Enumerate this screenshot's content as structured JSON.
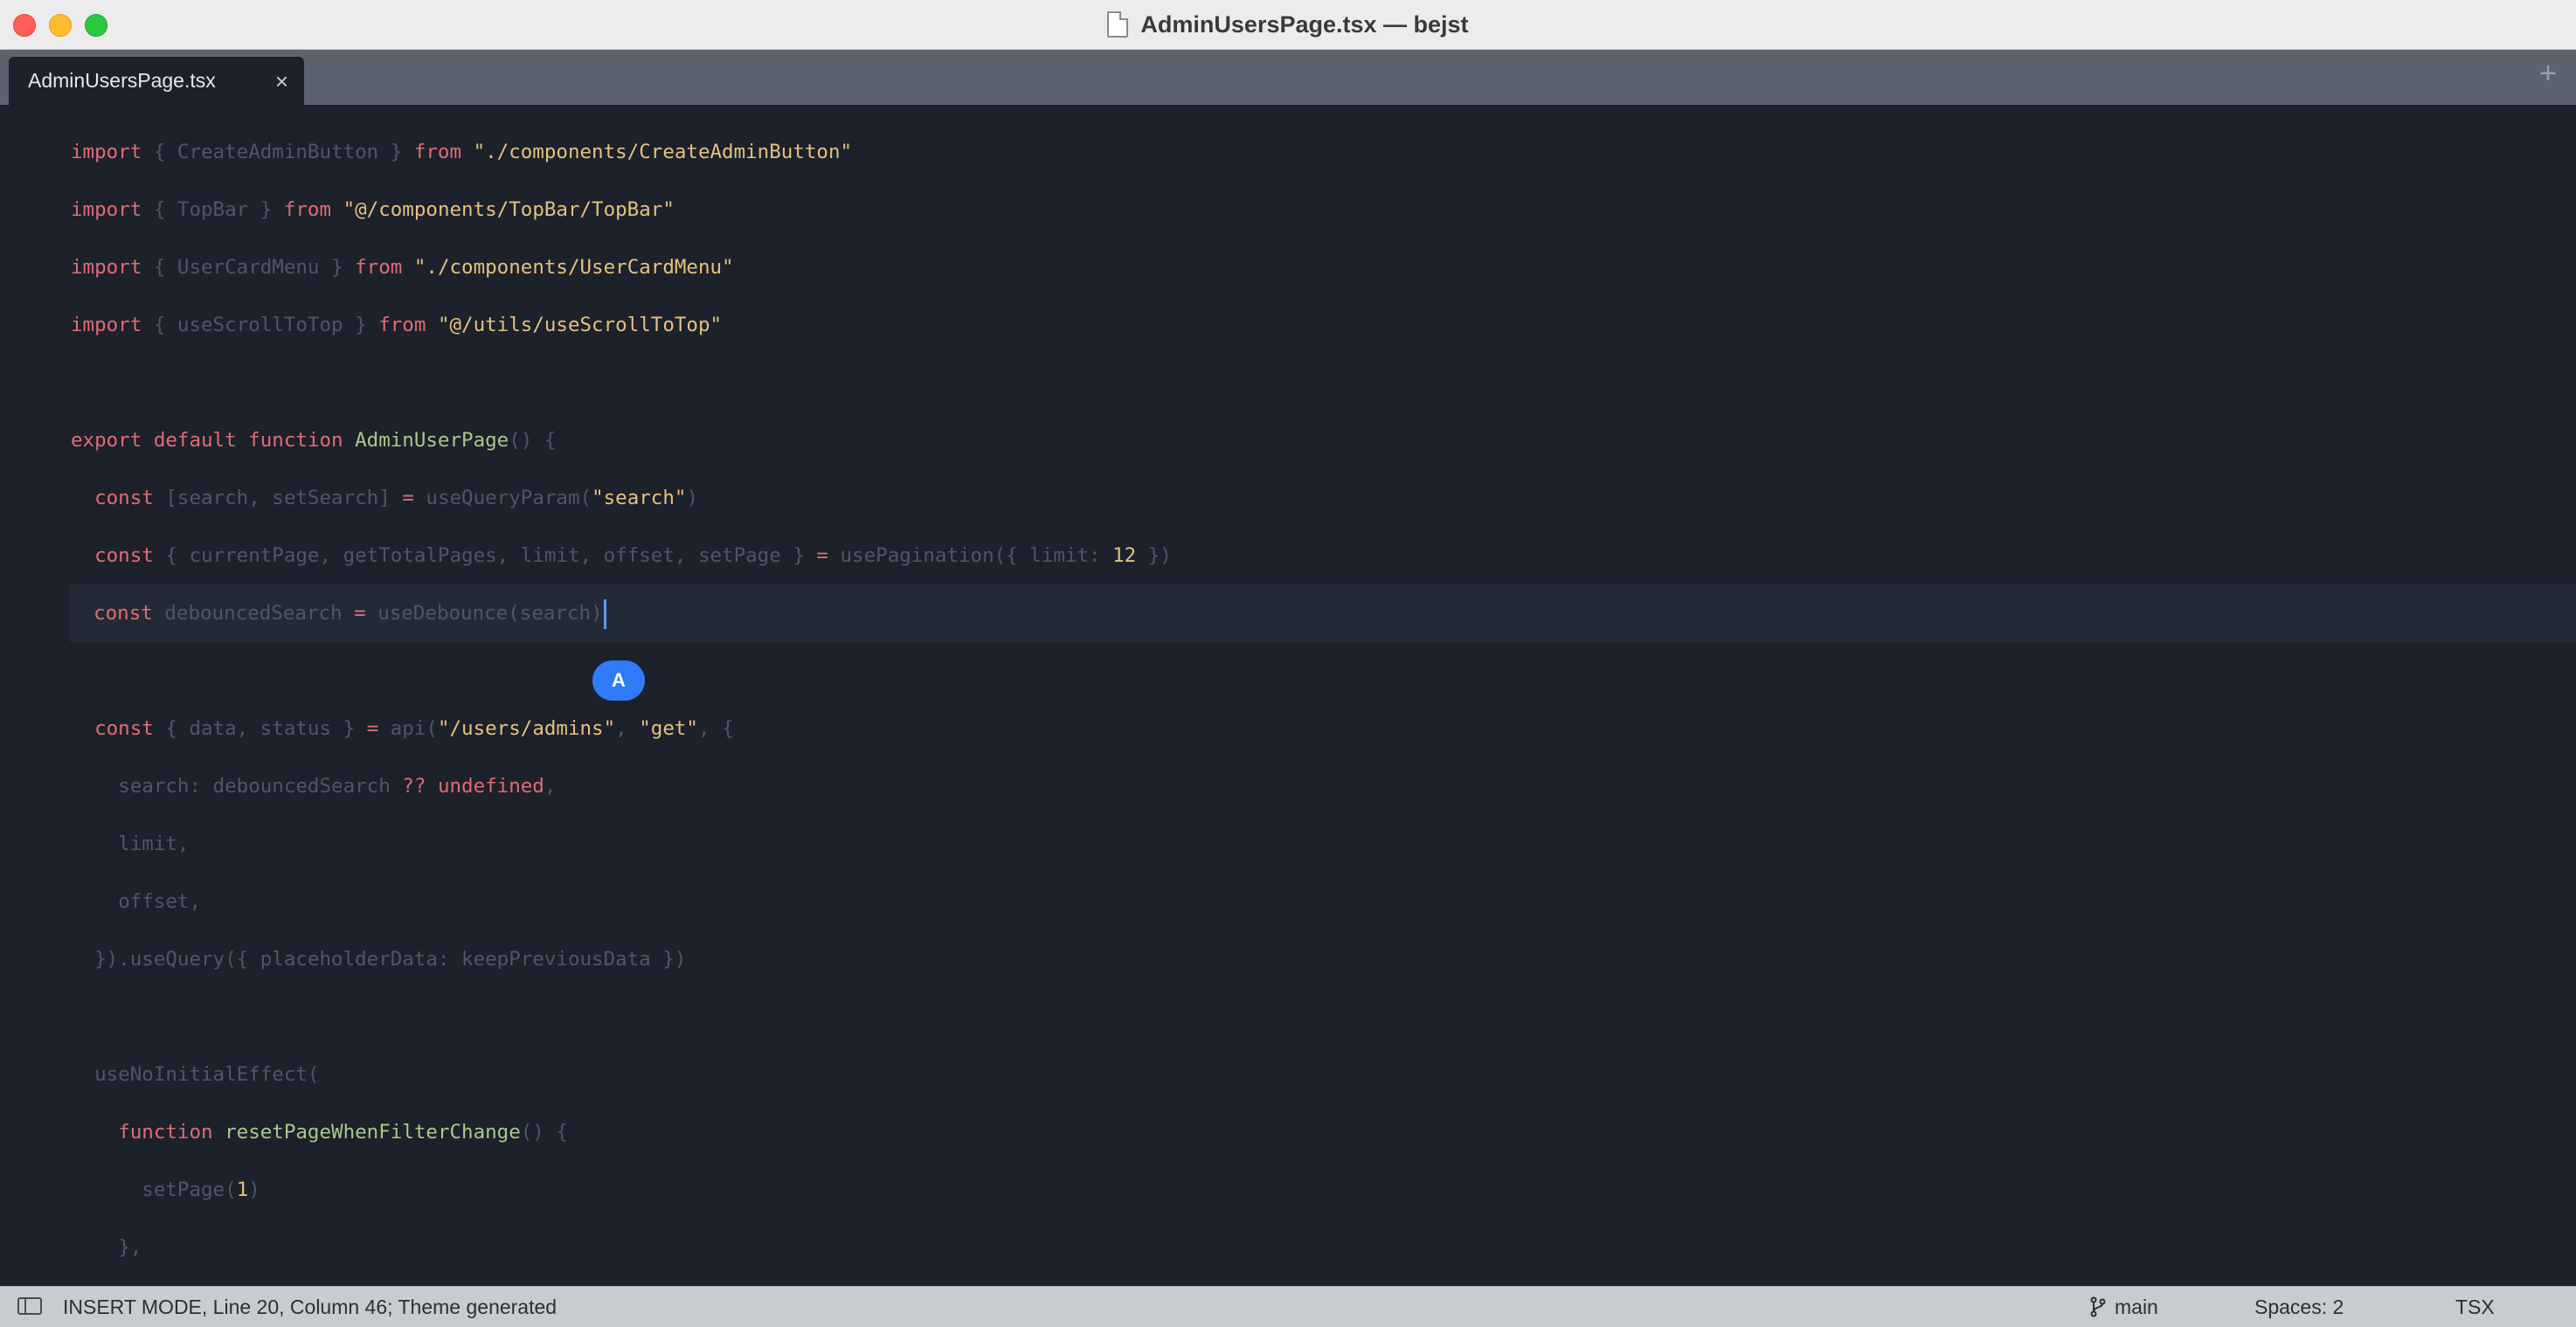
{
  "window": {
    "title": "AdminUsersPage.tsx — bejst"
  },
  "tabs": [
    {
      "label": "AdminUsersPage.tsx",
      "close": "×"
    }
  ],
  "tab_add": "+",
  "code_lines": [
    [
      "kw:import",
      "dim: { CreateAdminButton } ",
      "kw:from",
      "txt: ",
      "str:\"./components/CreateAdminButton\""
    ],
    [
      "kw:import",
      "dim: { TopBar } ",
      "kw:from",
      "txt: ",
      "str:\"@/components/TopBar/TopBar\""
    ],
    [
      "kw:import",
      "dim: { UserCardMenu } ",
      "kw:from",
      "txt: ",
      "str:\"./components/UserCardMenu\""
    ],
    [
      "kw:import",
      "dim: { useScrollToTop } ",
      "kw:from",
      "txt: ",
      "str:\"@/utils/useScrollToTop\""
    ],
    [],
    [
      "kw:export default function",
      "txt: ",
      "fn:AdminUserPage",
      "dim:() {"
    ],
    [
      "txt:  ",
      "kw:const",
      "dim: [search, setSearch] ",
      "kw:=",
      "dim: useQueryParam(",
      "str:\"search\"",
      "dim:)"
    ],
    [
      "txt:  ",
      "kw:const",
      "dim: { currentPage, getTotalPages, limit, offset, setPage } ",
      "kw:=",
      "dim: usePagination({ limit: ",
      "num:12",
      "dim: })"
    ],
    [
      "txt:  ",
      "kw:const",
      "dim: debouncedSearch ",
      "kw:=",
      "dim: useDebounce(search)"
    ],
    [],
    [
      "txt:  ",
      "kw:const",
      "dim: { data, status } ",
      "kw:=",
      "dim: api(",
      "str:\"/users/admins\"",
      "dim:, ",
      "str:\"get\"",
      "dim:, {"
    ],
    [
      "txt:    ",
      "dim:search: debouncedSearch ",
      "kw:??",
      "txt: ",
      "kw:undefined",
      "dim:,"
    ],
    [
      "txt:    ",
      "dim:limit,"
    ],
    [
      "txt:    ",
      "dim:offset,"
    ],
    [
      "txt:  ",
      "dim:}).useQuery({ placeholderData: keepPreviousData })"
    ],
    [],
    [
      "txt:  ",
      "dim:useNoInitialEffect("
    ],
    [
      "txt:    ",
      "kw:function",
      "txt: ",
      "fn:resetPageWhenFilterChange",
      "dim:() {"
    ],
    [
      "txt:      ",
      "dim:setPage(",
      "num:1",
      "dim:)"
    ],
    [
      "txt:    ",
      "dim:},"
    ]
  ],
  "current_line_index": 8,
  "collaborator_avatar": "A",
  "status": {
    "mode": "INSERT MODE, Line 20, Column 46; Theme generated",
    "branch": "main",
    "spaces": "Spaces: 2",
    "language": "TSX"
  }
}
